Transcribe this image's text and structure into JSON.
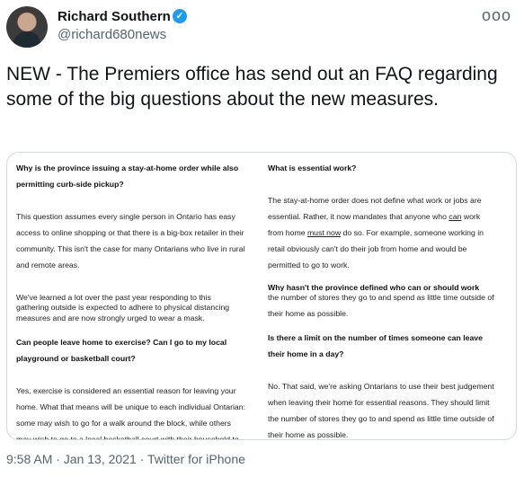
{
  "author": {
    "name": "Richard Southern",
    "handle": "@richard680news",
    "verified_icon": "verified-badge-icon",
    "avatar_icon": "avatar-photo"
  },
  "menu": {
    "more_label": "ooo"
  },
  "tweet": {
    "text": "NEW - The Premiers office has send out an FAQ regarding some of the big questions about the new measures."
  },
  "faq": {
    "left": {
      "q1_a": "Why is the province issuing a stay-at-home order while also",
      "q1_b": "permitting curb-side pickup?",
      "a1_1": "This question assumes every single person in Ontario has easy",
      "a1_2": "access to online shopping or that there is a big-box retailer in their",
      "a1_3": "community. This isn't the case for many Ontarians who live in rural",
      "a1_4": "and remote areas.",
      "a2_1": "We've learned a lot over the past year responding to this",
      "a2_2": "gathering outside is expected to adhere to physical distancing",
      "a2_3": "measures and are now strongly urged to wear a mask.",
      "q2_a": "Can people leave home to exercise? Can I go to my local",
      "q2_b": "playground or basketball court?",
      "a3_1": "Yes, exercise is considered an essential reason for leaving your",
      "a3_2": "home. What that means will be unique to each individual Ontarian:",
      "a3_3": "some may wish to go for a walk around the block, while others",
      "a3_4": "may wish to go to a local basketball court with their household to"
    },
    "right": {
      "q1": "What is essential work?",
      "a1_1": "The stay-at-home order does not define what work or jobs are",
      "a1_2a": "essential. Rather, it now mandates that anyone who ",
      "a1_2u": "can",
      "a1_2b": " work",
      "a1_3a": "from home ",
      "a1_3u": "must now",
      "a1_3b": " do so. For example, someone working in",
      "a1_4": "retail obviously can't do their job from home and would be",
      "a1_5": "permitted to go to work.",
      "q2": "Why hasn't the province defined who can or should work",
      "a2_1": "the number of stores they go to and spend as little time outside of",
      "a2_2": "their home as possible.",
      "q3_a": "Is there a limit on the number of times someone can leave",
      "q3_b": "their home in a day?",
      "a3_1": "No. That said, we're asking Ontarians to use their best judgement",
      "a3_2": "when leaving their home for essential reasons. They should limit",
      "a3_3": "the number of stores they go to and spend as little time outside of",
      "a3_4": "their home as possible."
    }
  },
  "footer": {
    "meta": "9:58 AM · Jan 13, 2021 · Twitter for iPhone"
  }
}
